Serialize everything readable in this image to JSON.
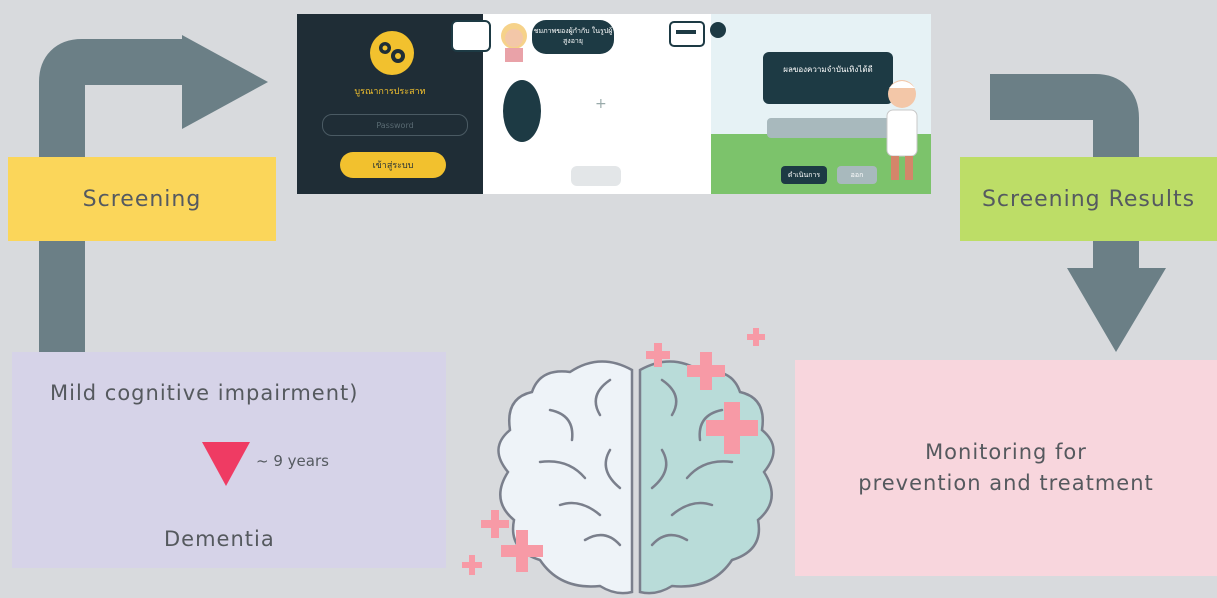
{
  "screening_label": "Screening",
  "results_label": "Screening Results",
  "mci": {
    "title": "Mild cognitive impairment)",
    "interval": "~ 9 years",
    "outcome": "Dementia"
  },
  "monitoring": {
    "line1": "Monitoring for",
    "line2": "prevention and treatment"
  },
  "app_screens": {
    "login_title": "บูรณาการประสาท",
    "password_placeholder": "Password",
    "login_button": "เข้าสู่ระบบ",
    "speech_text": "ชมภาพของผู้กำกับ ในรูปผู้สูงอายุ",
    "result_text": "ผลของความจำบันเทิงได้ดี",
    "continue_button": "ดำเนินการ",
    "close_button": "ออก"
  },
  "colors": {
    "screening": "#fbd65a",
    "results": "#bddd67",
    "mci": "#d6d3e8",
    "monitoring": "#f8d6dd",
    "arrow": "#6b7f86",
    "decline": "#ef3b63",
    "plus": "#f79aa6"
  }
}
